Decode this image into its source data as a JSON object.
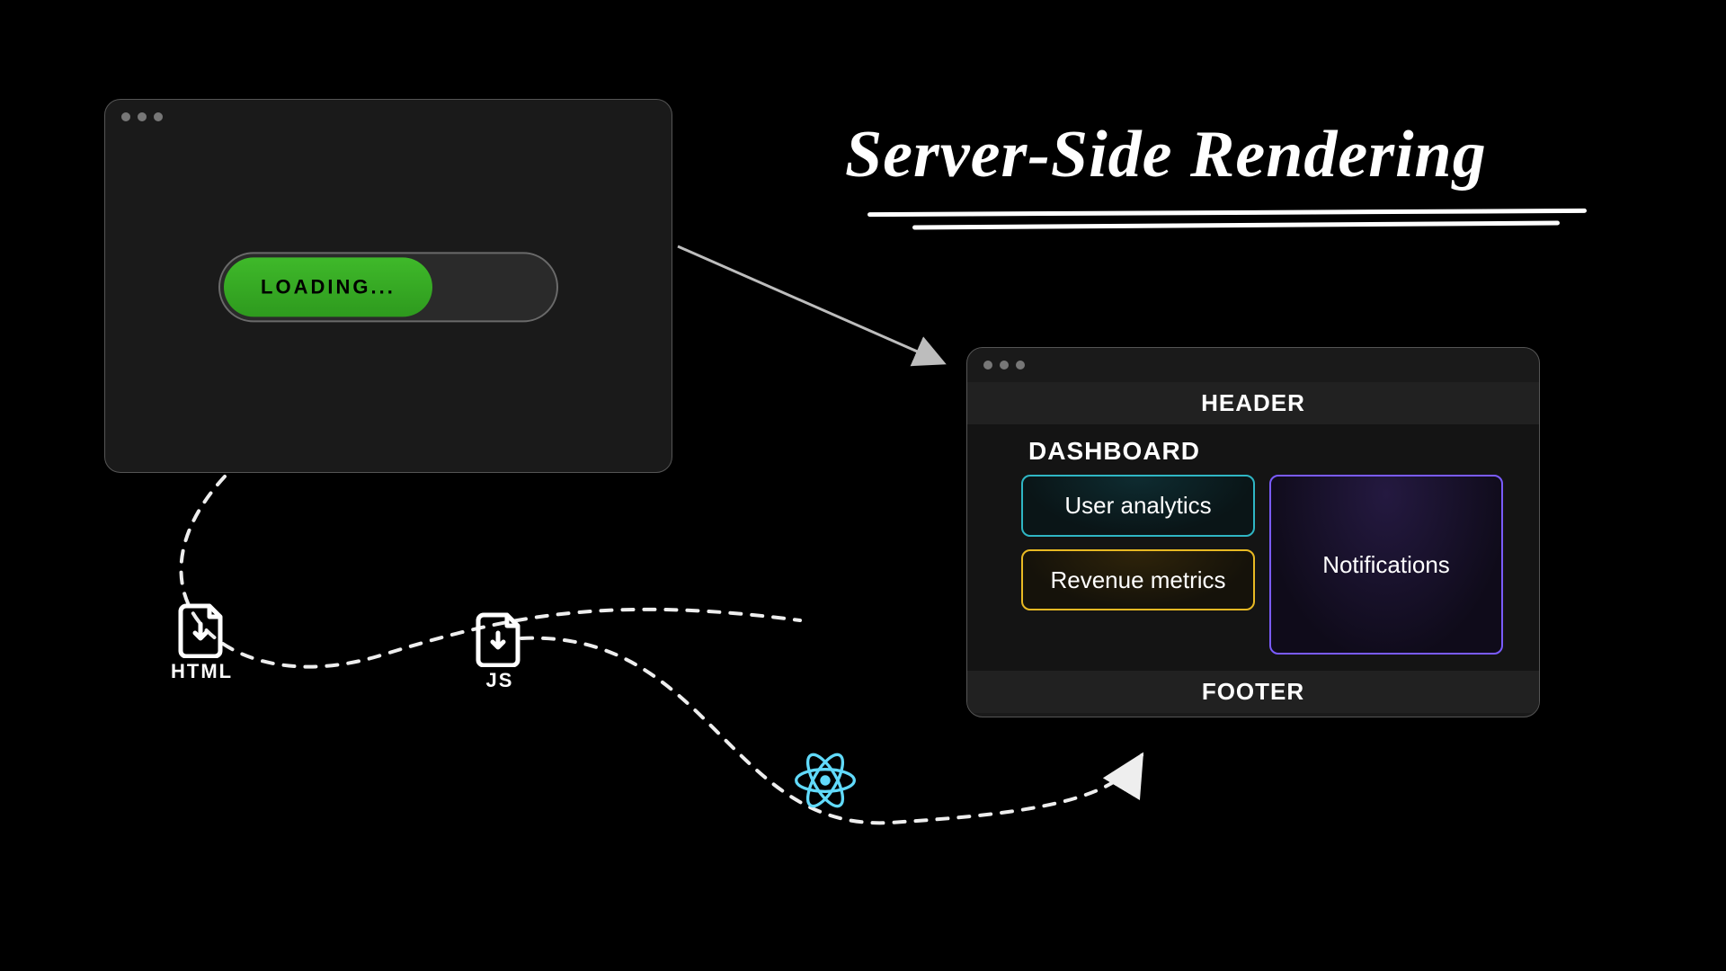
{
  "title": "Server-Side Rendering",
  "loading": {
    "label": "LOADING..."
  },
  "rendered": {
    "header": "HEADER",
    "footer": "FOOTER",
    "dashboard_title": "DASHBOARD",
    "cards": {
      "analytics": "User analytics",
      "revenue": "Revenue metrics",
      "notifications": "Notifications"
    }
  },
  "icons": {
    "html_label": "HTML",
    "js_label": "JS"
  }
}
